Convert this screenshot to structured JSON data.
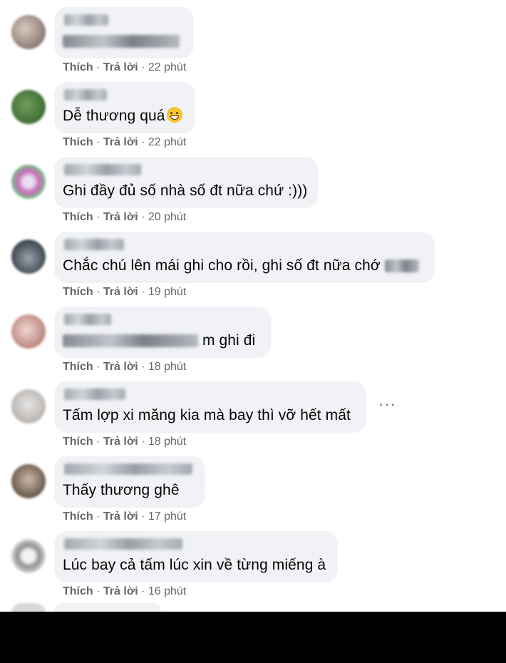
{
  "labels": {
    "like": "Thích",
    "reply": "Trả lời",
    "sep": "·"
  },
  "more_icon": "···",
  "comments": [
    {
      "text": "",
      "time": "22 phút"
    },
    {
      "text": "Dễ thương quá",
      "time": "22 phút"
    },
    {
      "text": "Ghi đầy đủ số nhà số đt nữa chứ :)))",
      "time": "20 phút"
    },
    {
      "text": "Chắc chú lên mái ghi cho rồi, ghi số đt nữa chớ",
      "time": "19 phút"
    },
    {
      "text": "m ghi đi",
      "time": "18 phút"
    },
    {
      "text": "Tấm lợp xi măng kia mà bay thì vỡ hết mất",
      "time": "18 phút"
    },
    {
      "text": "Thấy thương ghê",
      "time": "17 phút"
    },
    {
      "text": "Lúc bay cả tấm lúc xin về từng miếng à",
      "time": "16 phút"
    }
  ]
}
